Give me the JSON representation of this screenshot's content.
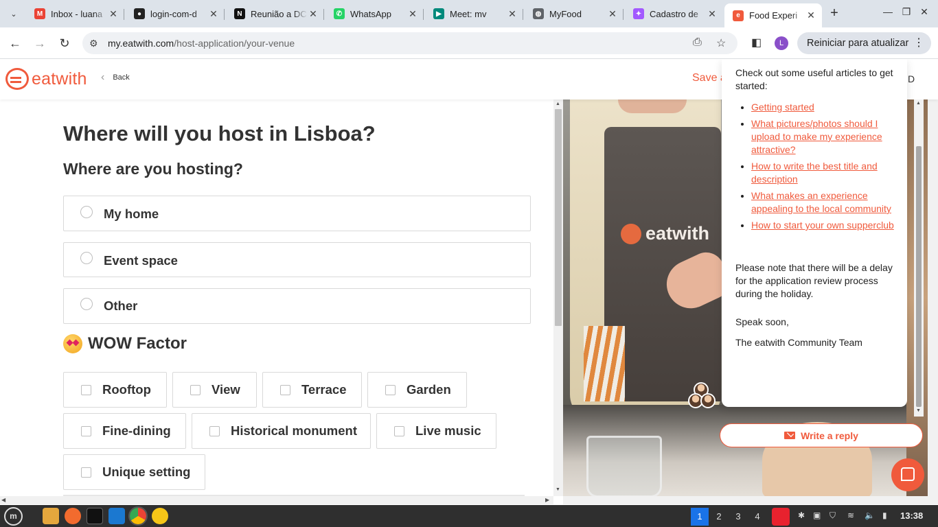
{
  "browser": {
    "tabs": [
      {
        "title": "Inbox - luana",
        "icon": "gmail-icon",
        "color": "#ea4335",
        "glyph": "M"
      },
      {
        "title": "login-com-d",
        "icon": "github-icon",
        "color": "#222222",
        "glyph": "●"
      },
      {
        "title": "Reunião a DC",
        "icon": "notion-icon",
        "color": "#111111",
        "glyph": "N"
      },
      {
        "title": "WhatsApp",
        "icon": "whatsapp-icon",
        "color": "#25d366",
        "glyph": "✆"
      },
      {
        "title": "Meet: mv",
        "icon": "meet-icon",
        "color": "#00897b",
        "glyph": "▶"
      },
      {
        "title": "MyFood",
        "icon": "globe-icon",
        "color": "#5f6368",
        "glyph": "◍"
      },
      {
        "title": "Cadastro de",
        "icon": "figma-icon",
        "color": "#a259ff",
        "glyph": "✦"
      },
      {
        "title": "Food Experi",
        "icon": "eatwith-icon",
        "color": "#f05a3c",
        "glyph": "e",
        "active": true
      }
    ],
    "url_host": "my.eatwith.com",
    "url_path": "/host-application/your-venue",
    "relaunch_label": "Reiniciar para atualizar",
    "profile_initial": "L"
  },
  "header": {
    "logo_text": "eatwith",
    "back_label": "Back",
    "save_label": "Save a",
    "right_letter": "D"
  },
  "form": {
    "title": "Where will you host in Lisboa?",
    "subtitle": "Where are you hosting?",
    "venue_options": [
      "My home",
      "Event space",
      "Other"
    ],
    "wow_title": "WOW Factor",
    "wow_options": [
      "Rooftop",
      "View",
      "Terrace",
      "Garden",
      "Fine-dining",
      "Historical monument",
      "Live music",
      "Unique setting"
    ]
  },
  "photo": {
    "apron_text": "eatwith"
  },
  "messenger": {
    "intro": "Check out some useful articles to get started:",
    "articles": [
      "Getting started",
      "What pictures/photos should I upload to make my experience attractive?",
      "How to write the best title and description",
      "What makes an experience appealing to the local community",
      "How to start your own supperclub"
    ],
    "note": "Please note that there will be a delay for the application review process during the holiday.",
    "closing": "Speak soon,",
    "signature": "The eatwith Community Team",
    "reply_label": "Write a reply"
  },
  "taskbar": {
    "workspaces": [
      "1",
      "2",
      "3",
      "4"
    ],
    "active_workspace": "1",
    "time": "13:38"
  },
  "colors": {
    "brand": "#f05a3c",
    "chrome_bg": "#dde3ea",
    "taskbar": "#2f2f2f",
    "workspace_active": "#1a73e8"
  }
}
